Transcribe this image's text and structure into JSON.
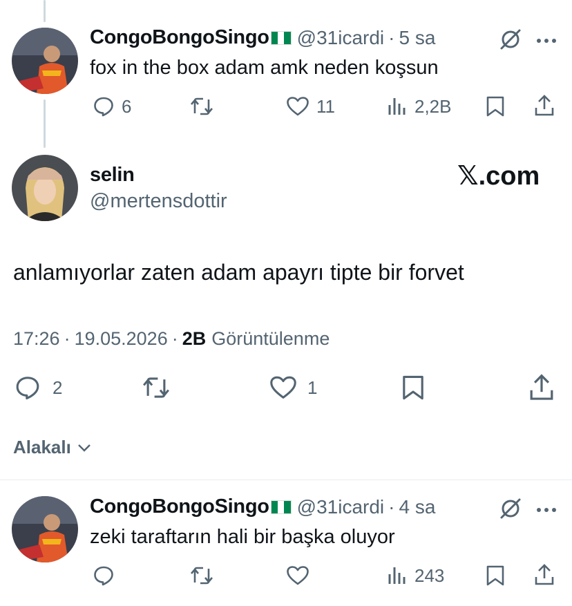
{
  "tweets": [
    {
      "display_name": "CongoBongoSingo",
      "handle": "@31icardi",
      "separator": "·",
      "time_ago": "5 sa",
      "text": "fox in the box adam amk neden koşsun",
      "replies": "6",
      "retweets": "",
      "likes": "11",
      "views": "2,2B"
    },
    {
      "display_name": "CongoBongoSingo",
      "handle": "@31icardi",
      "separator": "·",
      "time_ago": "4 sa",
      "text": "zeki taraftarın hali bir başka oluyor",
      "replies": "",
      "retweets": "",
      "likes": "",
      "views": "243"
    }
  ],
  "main_tweet": {
    "display_name": "selin",
    "handle": "@mertensdottir",
    "brand": "𝕏.com",
    "text": "anlamıyorlar zaten adam apayrı tipte bir forvet",
    "time": "17:26",
    "date": "19.05.2026",
    "views_count": "2B",
    "views_label": "Görüntülenme",
    "replies": "2",
    "likes": "1"
  },
  "related_label": "Alakalı",
  "flag_colors": [
    "#008751",
    "#ffffff",
    "#008751"
  ],
  "icons": [
    "grok-icon",
    "more-icon",
    "reply-icon",
    "retweet-icon",
    "like-icon",
    "views-icon",
    "bookmark-icon",
    "share-icon",
    "chevron-down-icon"
  ]
}
